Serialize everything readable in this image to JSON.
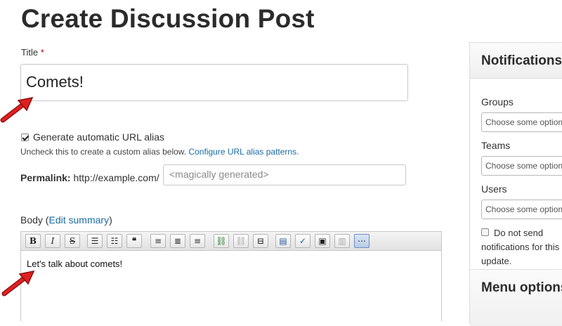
{
  "page": {
    "title": "Create Discussion Post"
  },
  "form": {
    "title_label": "Title",
    "required_mark": "*",
    "title_value": "Comets!",
    "auto_alias_label": "Generate automatic URL alias",
    "auto_alias_checked": true,
    "alias_description": "Uncheck this to create a custom alias below.",
    "alias_link": "Configure URL alias patterns.",
    "permalink_label": "Permalink:",
    "permalink_base": "http://example.com/",
    "alias_placeholder": "<magically generated>",
    "body_label": "Body",
    "edit_summary": "Edit summary",
    "body_text": "Let's talk about comets!"
  },
  "toolbar": {
    "buttons": [
      {
        "name": "bold-button",
        "glyph": "B"
      },
      {
        "name": "italic-button",
        "glyph": "I"
      },
      {
        "name": "strikethrough-button",
        "glyph": "S"
      },
      {
        "name": "bulleted-list-button",
        "glyph": "☰"
      },
      {
        "name": "numbered-list-button",
        "glyph": "☷"
      },
      {
        "name": "blockquote-button",
        "glyph": "❝"
      },
      {
        "name": "align-left-button",
        "glyph": "≡"
      },
      {
        "name": "align-center-button",
        "glyph": "≣"
      },
      {
        "name": "align-right-button",
        "glyph": "≡"
      },
      {
        "name": "link-button",
        "glyph": "⛓"
      },
      {
        "name": "unlink-button",
        "glyph": "⛓"
      },
      {
        "name": "page-break-button",
        "glyph": "⊟"
      },
      {
        "name": "template-button",
        "glyph": "▤"
      },
      {
        "name": "spellcheck-button",
        "glyph": "✓"
      },
      {
        "name": "image-button",
        "glyph": "▣"
      },
      {
        "name": "paste-button",
        "glyph": "▥"
      },
      {
        "name": "show-blocks-button",
        "glyph": "⋯",
        "active": true
      }
    ]
  },
  "sidebar": {
    "notifications_title": "Notifications",
    "groups_label": "Groups",
    "groups_placeholder": "Choose some options",
    "teams_label": "Teams",
    "teams_placeholder": "Choose some options",
    "users_label": "Users",
    "users_placeholder": "Choose some options",
    "no_notify_label": "Do not send notifications for this update.",
    "menu_title": "Menu options"
  },
  "colors": {
    "accent_link": "#1a6aa6",
    "required": "#cc0000",
    "arrow": "#d81a1a"
  }
}
